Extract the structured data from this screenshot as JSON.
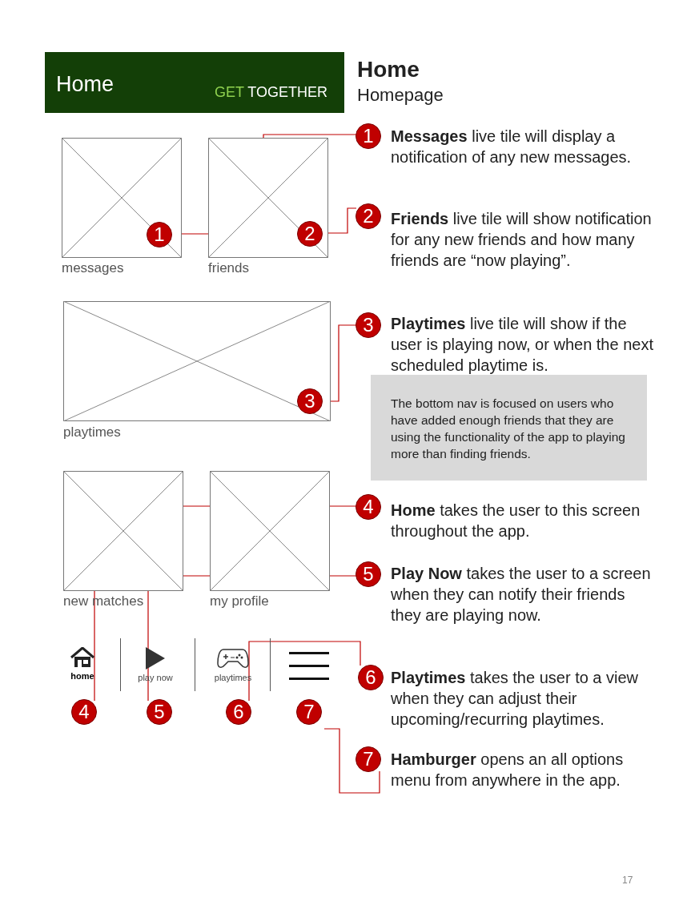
{
  "header": {
    "title": "Home",
    "tagline_accent": "GET",
    "tagline_rest": "TOGETHER"
  },
  "page_title": "Home",
  "page_subtitle": "Homepage",
  "tiles": [
    {
      "label": "messages",
      "marker": "1"
    },
    {
      "label": "friends",
      "marker": "2"
    },
    {
      "label": "playtimes",
      "marker": "3"
    },
    {
      "label": "new matches"
    },
    {
      "label": "my profile"
    }
  ],
  "nav": [
    {
      "kind": "home",
      "label": "home",
      "selected": true,
      "marker": "4"
    },
    {
      "kind": "play",
      "label": "play now",
      "selected": false,
      "marker": "5"
    },
    {
      "kind": "gamepad",
      "label": "playtimes",
      "selected": false,
      "marker": "6"
    },
    {
      "kind": "menu",
      "marker": "7"
    }
  ],
  "annotations": [
    {
      "number": "1",
      "text": "**Messages** live tile will display a notification of any new messages."
    },
    {
      "number": "2",
      "text": "**Friends** live tile will show notification for any new friends and how many friends are “now playing”."
    },
    {
      "number": "3",
      "text": "**Playtimes** live tile will show if the user is playing now, or when the next scheduled playtime is."
    },
    {
      "number": "4",
      "text": "**Home** takes the user to this screen throughout the app."
    },
    {
      "number": "5",
      "text": "**Play Now** takes the user to a screen when they can notify their friends they are playing now."
    },
    {
      "number": "6",
      "text": "**Playtimes** takes the user to a view when they can adjust their upcoming/recurring playtimes."
    },
    {
      "number": "7",
      "text": "**Hamburger** opens an all options menu from anywhere in the app."
    }
  ],
  "note": "The bottom nav is focused on users who have added enough friends that they are using the functionality of the app to playing more than finding friends.",
  "page_number": "17"
}
